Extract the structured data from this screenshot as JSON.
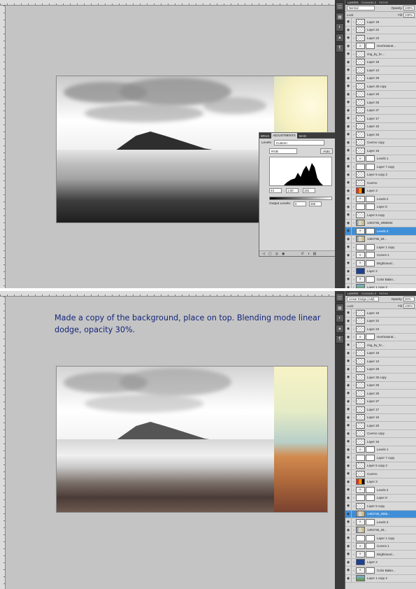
{
  "top_screen": {
    "adjustments_panel": {
      "tabs": [
        "BRUS",
        "ADJUSTMENTS",
        "MASI"
      ],
      "preset_label": "Levels",
      "preset_value": "Custom",
      "channel": "RGB",
      "auto_label": "Auto",
      "input_levels": [
        "43",
        "1.00",
        "191"
      ],
      "output_label": "Output Levels:",
      "output_levels": [
        "0",
        "255"
      ]
    },
    "layers_panel": {
      "tabs": [
        "LAYERS",
        "CHANNELS",
        "PATHS"
      ],
      "blend_mode": "Normal",
      "opacity_label": "Opacity:",
      "opacity": "100%",
      "lock_label": "Lock:",
      "fill_label": "Fill:",
      "fill": "100%",
      "layers": [
        {
          "name": "Layer 19",
          "kind": "pixel"
        },
        {
          "name": "Layer 22",
          "kind": "pixel"
        },
        {
          "name": "Layer 23",
          "kind": "pixel"
        },
        {
          "name": "Hue/Saturat...",
          "kind": "adjust"
        },
        {
          "name": "ring_by_hc...",
          "kind": "pixel"
        },
        {
          "name": "Layer 18",
          "kind": "pixel"
        },
        {
          "name": "Layer 13",
          "kind": "pixel"
        },
        {
          "name": "Layer 28",
          "kind": "pixel"
        },
        {
          "name": "Layer 25 copy",
          "kind": "pixel",
          "underline": true
        },
        {
          "name": "Layer 26",
          "kind": "pixel"
        },
        {
          "name": "Layer 25",
          "kind": "pixel",
          "underline": true
        },
        {
          "name": "Layer 27",
          "kind": "pixel"
        },
        {
          "name": "Layer 17",
          "kind": "pixel"
        },
        {
          "name": "Layer 15",
          "kind": "pixel"
        },
        {
          "name": "Layer 20",
          "kind": "pixel"
        },
        {
          "name": "Cuerno copy",
          "kind": "pixel"
        },
        {
          "name": "Layer 16",
          "kind": "pixel"
        },
        {
          "name": "Levels 1",
          "kind": "adjust"
        },
        {
          "name": "Layer 7 copy",
          "kind": "mask"
        },
        {
          "name": "Layer 5 copy 2",
          "kind": "pixel",
          "underline": true
        },
        {
          "name": "Cuerno",
          "kind": "pixel"
        },
        {
          "name": "Layer 3",
          "kind": "orange"
        },
        {
          "name": "Levels 2",
          "kind": "adjust"
        },
        {
          "name": "Layer 8",
          "kind": "mask"
        },
        {
          "name": "Layer 5 copy",
          "kind": "pixel",
          "underline": true
        },
        {
          "name": "1402736_2956934",
          "kind": "photo"
        },
        {
          "name": "Levels 3",
          "kind": "adjust",
          "selected": true
        },
        {
          "name": "1402736_29...",
          "kind": "photo"
        },
        {
          "name": "Layer 1 copy",
          "kind": "mask"
        },
        {
          "name": "Curves 1",
          "kind": "adjust"
        },
        {
          "name": "Brightness/...",
          "kind": "adjust"
        },
        {
          "name": "Layer 2",
          "kind": "blue"
        },
        {
          "name": "Color Balan...",
          "kind": "adjust"
        },
        {
          "name": "Layer 1 copy 2",
          "kind": "green",
          "underline": true
        }
      ]
    }
  },
  "bottom_screen": {
    "caption": "Made a copy of the background, place on top. Blending mode linear dodge, opacity 30%.",
    "layers_panel": {
      "tabs": [
        "LAYERS",
        "CHANNELS",
        "PATHS"
      ],
      "blend_mode": "Linear Dodge (Add)",
      "opacity_label": "Opacity:",
      "opacity": "30%",
      "lock_label": "Lock:",
      "fill_label": "Fill:",
      "fill": "100%",
      "layers": [
        {
          "name": "Layer 19",
          "kind": "pixel"
        },
        {
          "name": "Layer 22",
          "kind": "pixel"
        },
        {
          "name": "Layer 23",
          "kind": "pixel"
        },
        {
          "name": "Hue/Saturat...",
          "kind": "adjust"
        },
        {
          "name": "ring_by_hc...",
          "kind": "pixel"
        },
        {
          "name": "Layer 18",
          "kind": "pixel"
        },
        {
          "name": "Layer 13",
          "kind": "pixel"
        },
        {
          "name": "Layer 28",
          "kind": "pixel"
        },
        {
          "name": "Layer 25 copy",
          "kind": "pixel",
          "underline": true
        },
        {
          "name": "Layer 26",
          "kind": "pixel"
        },
        {
          "name": "Layer 25",
          "kind": "pixel",
          "underline": true
        },
        {
          "name": "Layer 27",
          "kind": "pixel"
        },
        {
          "name": "Layer 17",
          "kind": "pixel"
        },
        {
          "name": "Layer 15",
          "kind": "pixel"
        },
        {
          "name": "Layer 20",
          "kind": "pixel"
        },
        {
          "name": "Cuerno copy",
          "kind": "pixel",
          "underline": true
        },
        {
          "name": "Layer 16",
          "kind": "pixel"
        },
        {
          "name": "Levels 1",
          "kind": "adjust"
        },
        {
          "name": "Layer 7 copy",
          "kind": "mask"
        },
        {
          "name": "Layer 5 copy 2",
          "kind": "pixel",
          "underline": true
        },
        {
          "name": "Cuerno",
          "kind": "pixel"
        },
        {
          "name": "Layer 3",
          "kind": "orange"
        },
        {
          "name": "Levels 2",
          "kind": "adjust"
        },
        {
          "name": "Layer 8",
          "kind": "mask"
        },
        {
          "name": "Layer 5 copy",
          "kind": "pixel",
          "underline": true
        },
        {
          "name": "1402736_2955...",
          "kind": "photo",
          "selected": true
        },
        {
          "name": "Levels 3",
          "kind": "adjust"
        },
        {
          "name": "1402736_29...",
          "kind": "photo"
        },
        {
          "name": "Layer 1 copy",
          "kind": "mask"
        },
        {
          "name": "Curves 1",
          "kind": "adjust"
        },
        {
          "name": "Brightness/...",
          "kind": "adjust"
        },
        {
          "name": "Layer 2",
          "kind": "blue"
        },
        {
          "name": "Color Balan...",
          "kind": "adjust"
        },
        {
          "name": "Layer 1 copy 2",
          "kind": "green",
          "underline": true
        }
      ]
    }
  },
  "colors": {
    "canvas_bg": "#c4c4c4",
    "caption": "#13257a",
    "selection": "#3f8fd8"
  }
}
